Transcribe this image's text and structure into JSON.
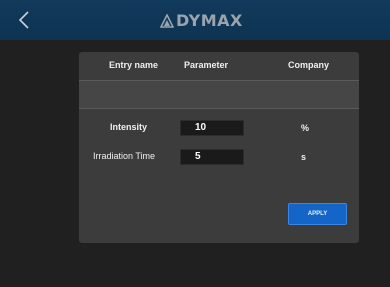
{
  "header": {
    "back_icon": "chevron-left-icon",
    "logo_text": "DYMAX",
    "logo_icon": "dymax-logo-mark"
  },
  "table": {
    "columns": [
      "Entry name",
      "Parameter",
      "Company"
    ],
    "rows": [
      {
        "label": "Intensity",
        "value": "10",
        "unit": "%"
      },
      {
        "label": "Irradiation Time",
        "value": "5",
        "unit": "s"
      }
    ]
  },
  "actions": {
    "apply_label": "APPLY"
  },
  "colors": {
    "topbar": "#123a5c",
    "background": "#202020",
    "panel": "#3c3c3c",
    "button": "#1565c8"
  }
}
